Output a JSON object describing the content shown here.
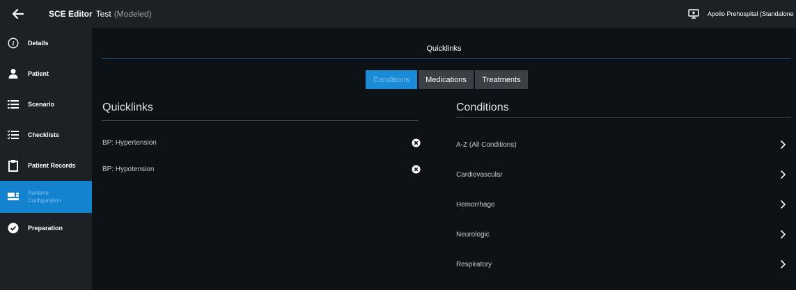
{
  "topbar": {
    "app_title": "SCE Editor",
    "doc_title": "Test",
    "doc_status": "(Modeled)",
    "device_name": "Apollo Prehospital (Standalone"
  },
  "sidebar": {
    "items": [
      {
        "label": "Details",
        "icon": "info-icon"
      },
      {
        "label": "Patient",
        "icon": "person-icon"
      },
      {
        "label": "Scenario",
        "icon": "list-icon"
      },
      {
        "label": "Checklists",
        "icon": "checklist-icon"
      },
      {
        "label": "Patient Records",
        "icon": "clipboard-icon"
      },
      {
        "label": "Runtime Configuration",
        "icon": "config-icon",
        "active": true
      },
      {
        "label": "Preparation",
        "icon": "check-circle-icon"
      }
    ]
  },
  "main": {
    "heading": "Quicklinks",
    "tabs": [
      {
        "label": "Conditions",
        "active": true
      },
      {
        "label": "Medications"
      },
      {
        "label": "Treatments"
      }
    ],
    "quicklinks": {
      "title": "Quicklinks",
      "items": [
        "BP: Hypertension",
        "BP: Hypotension"
      ]
    },
    "conditions": {
      "title": "Conditions",
      "items": [
        "A-Z (All Conditions)",
        "Cardiovascular",
        "Hemorrhage",
        "Neurologic",
        "Respiratory"
      ]
    }
  },
  "colors": {
    "accent": "#1383cf",
    "topbar_bg": "#1c2126",
    "main_bg": "#0c1115"
  }
}
